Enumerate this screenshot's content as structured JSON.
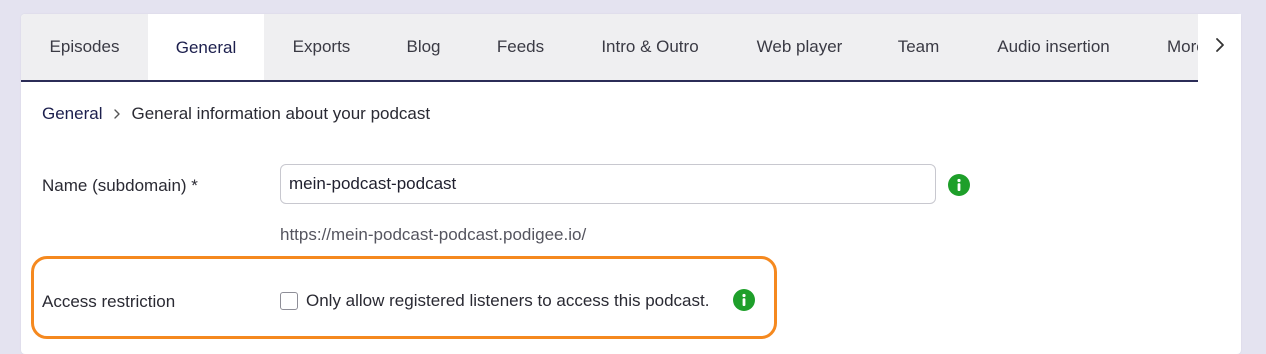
{
  "tabs": [
    {
      "label": "Episodes",
      "active": false
    },
    {
      "label": "General",
      "active": true
    },
    {
      "label": "Exports",
      "active": false
    },
    {
      "label": "Blog",
      "active": false
    },
    {
      "label": "Feeds",
      "active": false
    },
    {
      "label": "Intro & Outro",
      "active": false
    },
    {
      "label": "Web player",
      "active": false
    },
    {
      "label": "Team",
      "active": false
    },
    {
      "label": "Audio insertion",
      "active": false
    },
    {
      "label": "More",
      "active": false
    }
  ],
  "breadcrumb": {
    "parent": "General",
    "current": "General information about your podcast"
  },
  "form": {
    "name_label": "Name (subdomain) *",
    "name_value": "mein-podcast-podcast",
    "url_hint": "https://mein-podcast-podcast.podigee.io/",
    "access_label": "Access restriction",
    "access_checkbox_label": "Only allow registered listeners to access this podcast.",
    "access_checked": false
  },
  "colors": {
    "accent": "#1c1f4d",
    "info_icon": "#1e9f2a",
    "highlight": "#f5891f",
    "background": "#e4e3f0"
  }
}
